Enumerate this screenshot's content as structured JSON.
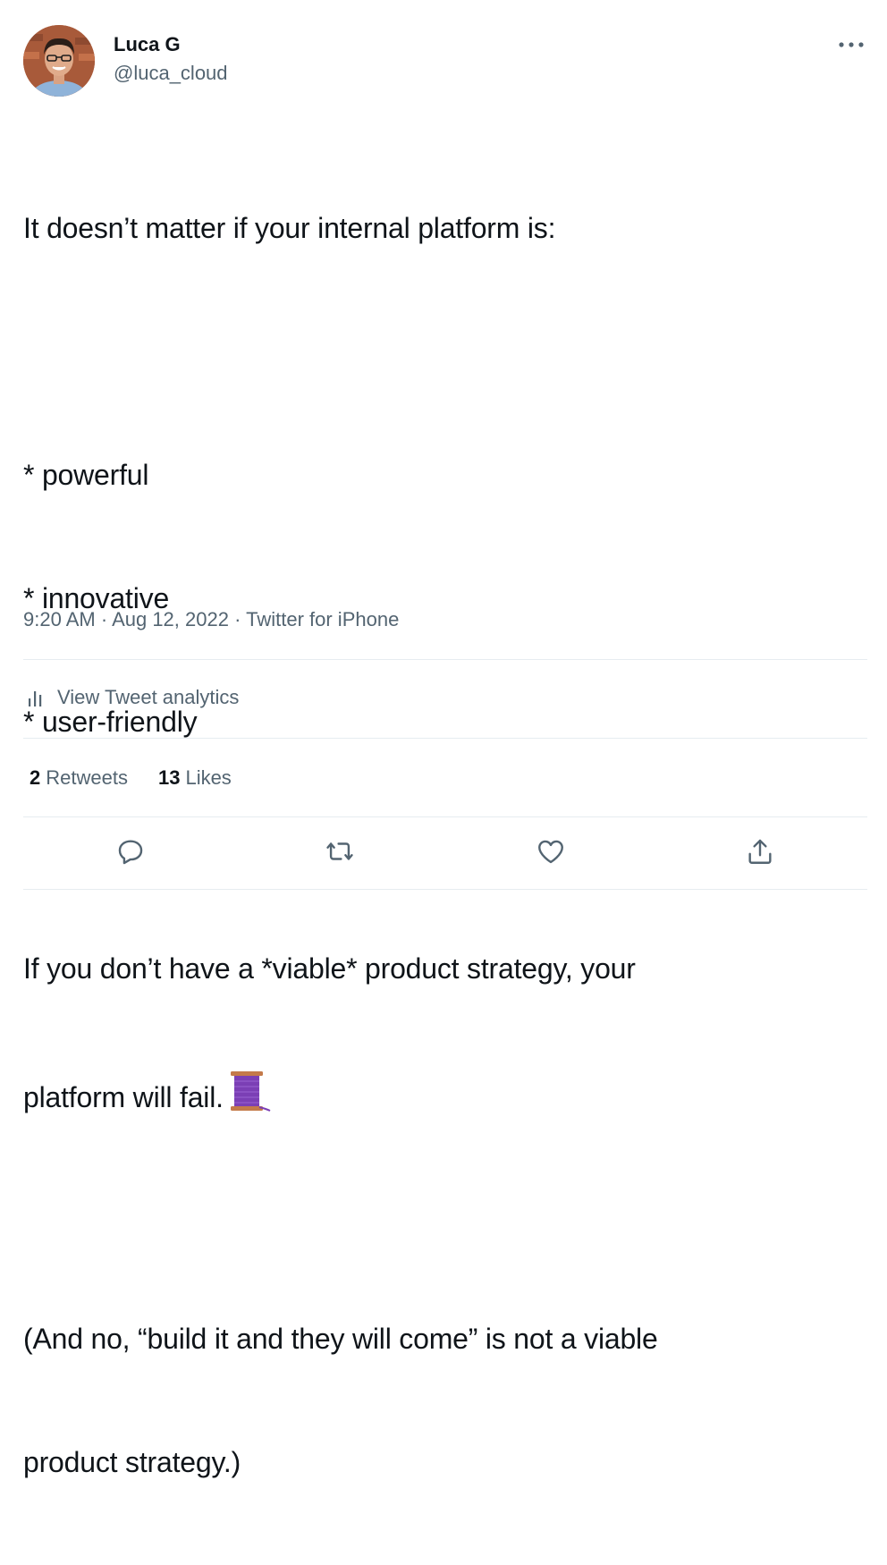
{
  "author": {
    "display_name": "Luca G",
    "handle": "@luca_cloud"
  },
  "more_icon": "more-horizontal-icon",
  "tweet": {
    "lines": [
      "It doesn’t matter if your internal platform is:",
      "",
      "* powerful",
      "* innovative",
      "* user-friendly",
      "",
      "If you don’t have a *viable* product strategy, your",
      "platform will fail.",
      "",
      "(And no, “build it and they will come” is not a viable",
      "product strategy.)"
    ],
    "emoji": "thread-spool-emoji"
  },
  "meta": {
    "time": "9:20 AM",
    "separator1": " · ",
    "date": "Aug 12, 2022",
    "separator2": " · ",
    "source": "Twitter for iPhone"
  },
  "analytics": {
    "label": "View Tweet analytics",
    "icon": "analytics-icon"
  },
  "stats": {
    "retweets_count": "2",
    "retweets_label": "Retweets",
    "likes_count": "13",
    "likes_label": "Likes"
  },
  "actions": [
    "reply-icon",
    "retweet-icon",
    "like-icon",
    "share-icon"
  ],
  "colors": {
    "text": "#0f1419",
    "secondary": "#536471",
    "divider": "#e6ecf0"
  }
}
